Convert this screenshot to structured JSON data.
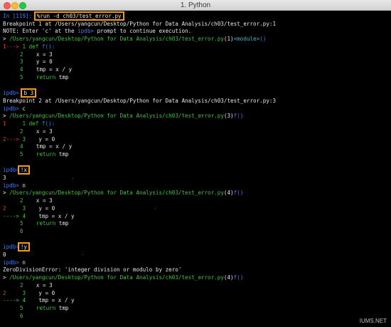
{
  "window": {
    "title": "1. Python"
  },
  "terminal": {
    "l01": {
      "prompt_in": "In [",
      "prompt_num": "119",
      "prompt_close": "]:",
      "cmd": "%run -d ch03/test_error.py"
    },
    "l02": "Breakpoint 1 at /Users/yangcun/Desktop/Python for Data Analysis/ch03/test_error.py:1",
    "l03a": "NOTE: Enter 'c' at the ",
    "l03b": "ipdb>",
    "l03c": " prompt to continue execution.",
    "l04": {
      "arrow": ">",
      "path": " /Users/yangcun/Desktop/Python for Data Analysis/ch03/test_error.py",
      "lineno": "(1)",
      "module": "<module>",
      "paren": "()"
    },
    "l05": {
      "marker": "1---> ",
      "num": "1",
      "def": " def ",
      "fn": "f",
      "parens": "():"
    },
    "l06": {
      "num": "2",
      "code": "x = 3"
    },
    "l07": {
      "num": "3",
      "code": "y = 0"
    },
    "l08": {
      "num": "4",
      "code": "tmp = x / y"
    },
    "l09": {
      "num": "5",
      "kw": "return",
      "val": " tmp"
    },
    "l11": {
      "prompt": "ipdb>",
      "cmd": "b 3"
    },
    "l12": "Breakpoint 2 at /Users/yangcun/Desktop/Python for Data Analysis/ch03/test_error.py:3",
    "l13": {
      "prompt": "ipdb>",
      "cmd": " c"
    },
    "l14": {
      "arrow": ">",
      "path": " /Users/yangcun/Desktop/Python for Data Analysis/ch03/test_error.py",
      "lineno": "(3)",
      "fn": "f",
      "paren": "()"
    },
    "l15": {
      "marker": "1",
      "num": "1",
      "def": " def ",
      "fn": "f",
      "parens": "():"
    },
    "l16": {
      "num": "2",
      "code": "x = 3"
    },
    "l17": {
      "marker": "2---> ",
      "num": "3",
      "code": "y = 0"
    },
    "l18": {
      "num": "4",
      "code": "tmp = x / y"
    },
    "l19": {
      "num": "5",
      "kw": "return",
      "val": " tmp"
    },
    "l21": {
      "prompt": "ipdb>",
      "cmd": "!x"
    },
    "l22": "3",
    "l23": {
      "prompt": "ipdb>",
      "cmd": " n"
    },
    "l24": {
      "arrow": ">",
      "path": " /Users/yangcun/Desktop/Python for Data Analysis/ch03/test_error.py",
      "lineno": "(4)",
      "fn": "f",
      "paren": "()"
    },
    "l25": {
      "num": "2",
      "code": "x = 3"
    },
    "l26": {
      "marker": "2",
      "num": "3",
      "code": "y = 0"
    },
    "l27": {
      "marker": "----> ",
      "num": "4",
      "code": "tmp = x / y"
    },
    "l28": {
      "num": "5",
      "kw": "return",
      "val": " tmp"
    },
    "l29": {
      "num": "6"
    },
    "l31": {
      "prompt": "ipdb>",
      "cmd": "!y"
    },
    "l32": "0",
    "l33": {
      "prompt": "ipdb>",
      "cmd": " n"
    },
    "l34": "ZeroDivisionError: 'integer division or modulo by zero'",
    "l35": {
      "arrow": ">",
      "path": " /Users/yangcun/Desktop/Python for Data Analysis/ch03/test_error.py",
      "lineno": "(4)",
      "fn": "f",
      "paren": "()"
    },
    "l36": {
      "num": "2",
      "code": "x = 3"
    },
    "l37": {
      "marker": "2",
      "num": "3",
      "code": "y = 0"
    },
    "l38": {
      "marker": "----> ",
      "num": "4",
      "code": "tmp = x / y"
    },
    "l39": {
      "num": "5",
      "kw": "return",
      "val": " tmp"
    },
    "l40": {
      "num": "6"
    }
  },
  "watermark": "IUMS.NET",
  "colors": {
    "prompt_blue": "#3d7df2",
    "path_green": "#3fc23f",
    "marker_red": "#e23a3a",
    "highlight_orange": "#f29a1c"
  }
}
